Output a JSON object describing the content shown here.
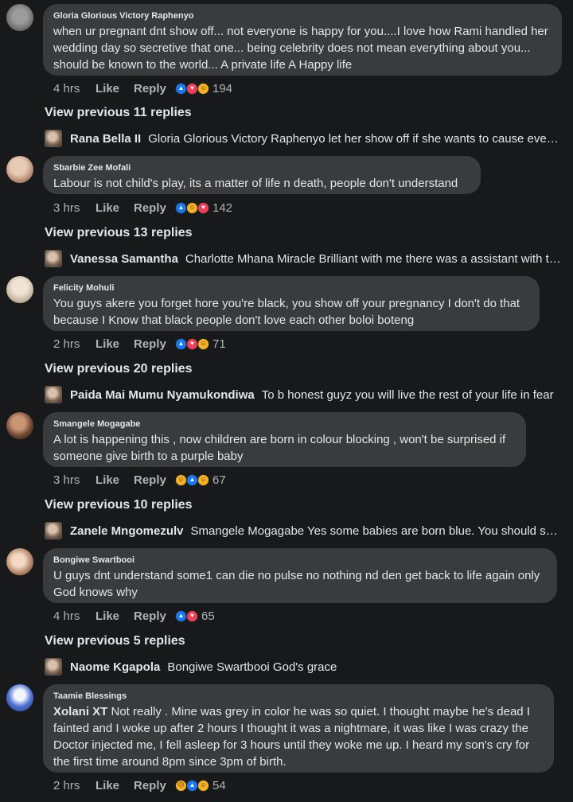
{
  "comments": [
    {
      "author": "Gloria Glorious Victory Raphenyo",
      "text": "when ur pregnant dnt show off... not everyone is happy for you....I love how Rami handled her wedding day so secretive that one... being celebrity does not mean everything about you... should be known to the world... A private life A Happy life",
      "time": "4 hrs",
      "like": "Like",
      "reply": "Reply",
      "reactions": [
        "like",
        "love",
        "haha"
      ],
      "count": "194",
      "view_previous": "View previous 11 replies",
      "reply_author": "Rana Bella II",
      "reply_text": "Gloria Glorious Victory Raphenyo let her show off if she wants to cause every one is different"
    },
    {
      "author": "Sbarbie Zee Mofali",
      "text": "Labour is not child's play, its a matter of life n death, people don't understand",
      "time": "3 hrs",
      "like": "Like",
      "reply": "Reply",
      "reactions": [
        "like",
        "haha",
        "love"
      ],
      "count": "142",
      "view_previous": "View previous 13 replies",
      "reply_author": "Vanessa Samantha",
      "reply_text": "Charlotte Mhana Miracle Brilliant with me there was a assistant with the doctor"
    },
    {
      "author": "Felicity Mohuli",
      "text": "You guys akere you forget hore you're black, you show off your pregnancy I don't do that because I Know that black people don't love each other boloi boteng",
      "time": "2 hrs",
      "like": "Like",
      "reply": "Reply",
      "reactions": [
        "like",
        "love",
        "haha"
      ],
      "count": "71",
      "view_previous": "View previous 20 replies",
      "reply_author": "Paida Mai Mumu Nyamukondiwa",
      "reply_text": "To b honest guyz you will live the rest of your life in fear"
    },
    {
      "author": "Smangele Mogagabe",
      "text": "A lot is happening this , now children are born in colour blocking , won't be surprised if someone give birth to a purple baby",
      "time": "3 hrs",
      "like": "Like",
      "reply": "Reply",
      "reactions": [
        "haha",
        "like",
        "haha"
      ],
      "count": "67",
      "view_previous": "View previous 10 replies",
      "reply_author": "Zanele Mngomezulv",
      "reply_text": "Smangele Mogagabe Yes some babies are born blue. You should see them"
    },
    {
      "author": "Bongiwe Swartbooi",
      "text": "U guys dnt understand some1 can die no pulse no nothing nd den get back to life again only God knows why",
      "time": "4 hrs",
      "like": "Like",
      "reply": "Reply",
      "reactions": [
        "like",
        "love"
      ],
      "count": "65",
      "view_previous": "View previous 5 replies",
      "reply_author": "Naome Kgapola",
      "reply_text": "Bongiwe Swartbooi God's grace"
    },
    {
      "author": "Taamie Blessings",
      "tag": "Xolani XT",
      "text": " Not really .  Mine was grey in color he was so quiet.  I thought maybe he's dead I fainted and I woke up after 2 hours I thought it was a nightmare, it was like I was crazy  the Doctor injected me, I fell asleep for 3 hours until they woke me up.  I heard my son's cry for the first time around 8pm since 3pm of birth.",
      "time": "2 hrs",
      "like": "Like",
      "reply": "Reply",
      "reactions": [
        "sad",
        "like",
        "haha"
      ],
      "count": "54"
    }
  ]
}
